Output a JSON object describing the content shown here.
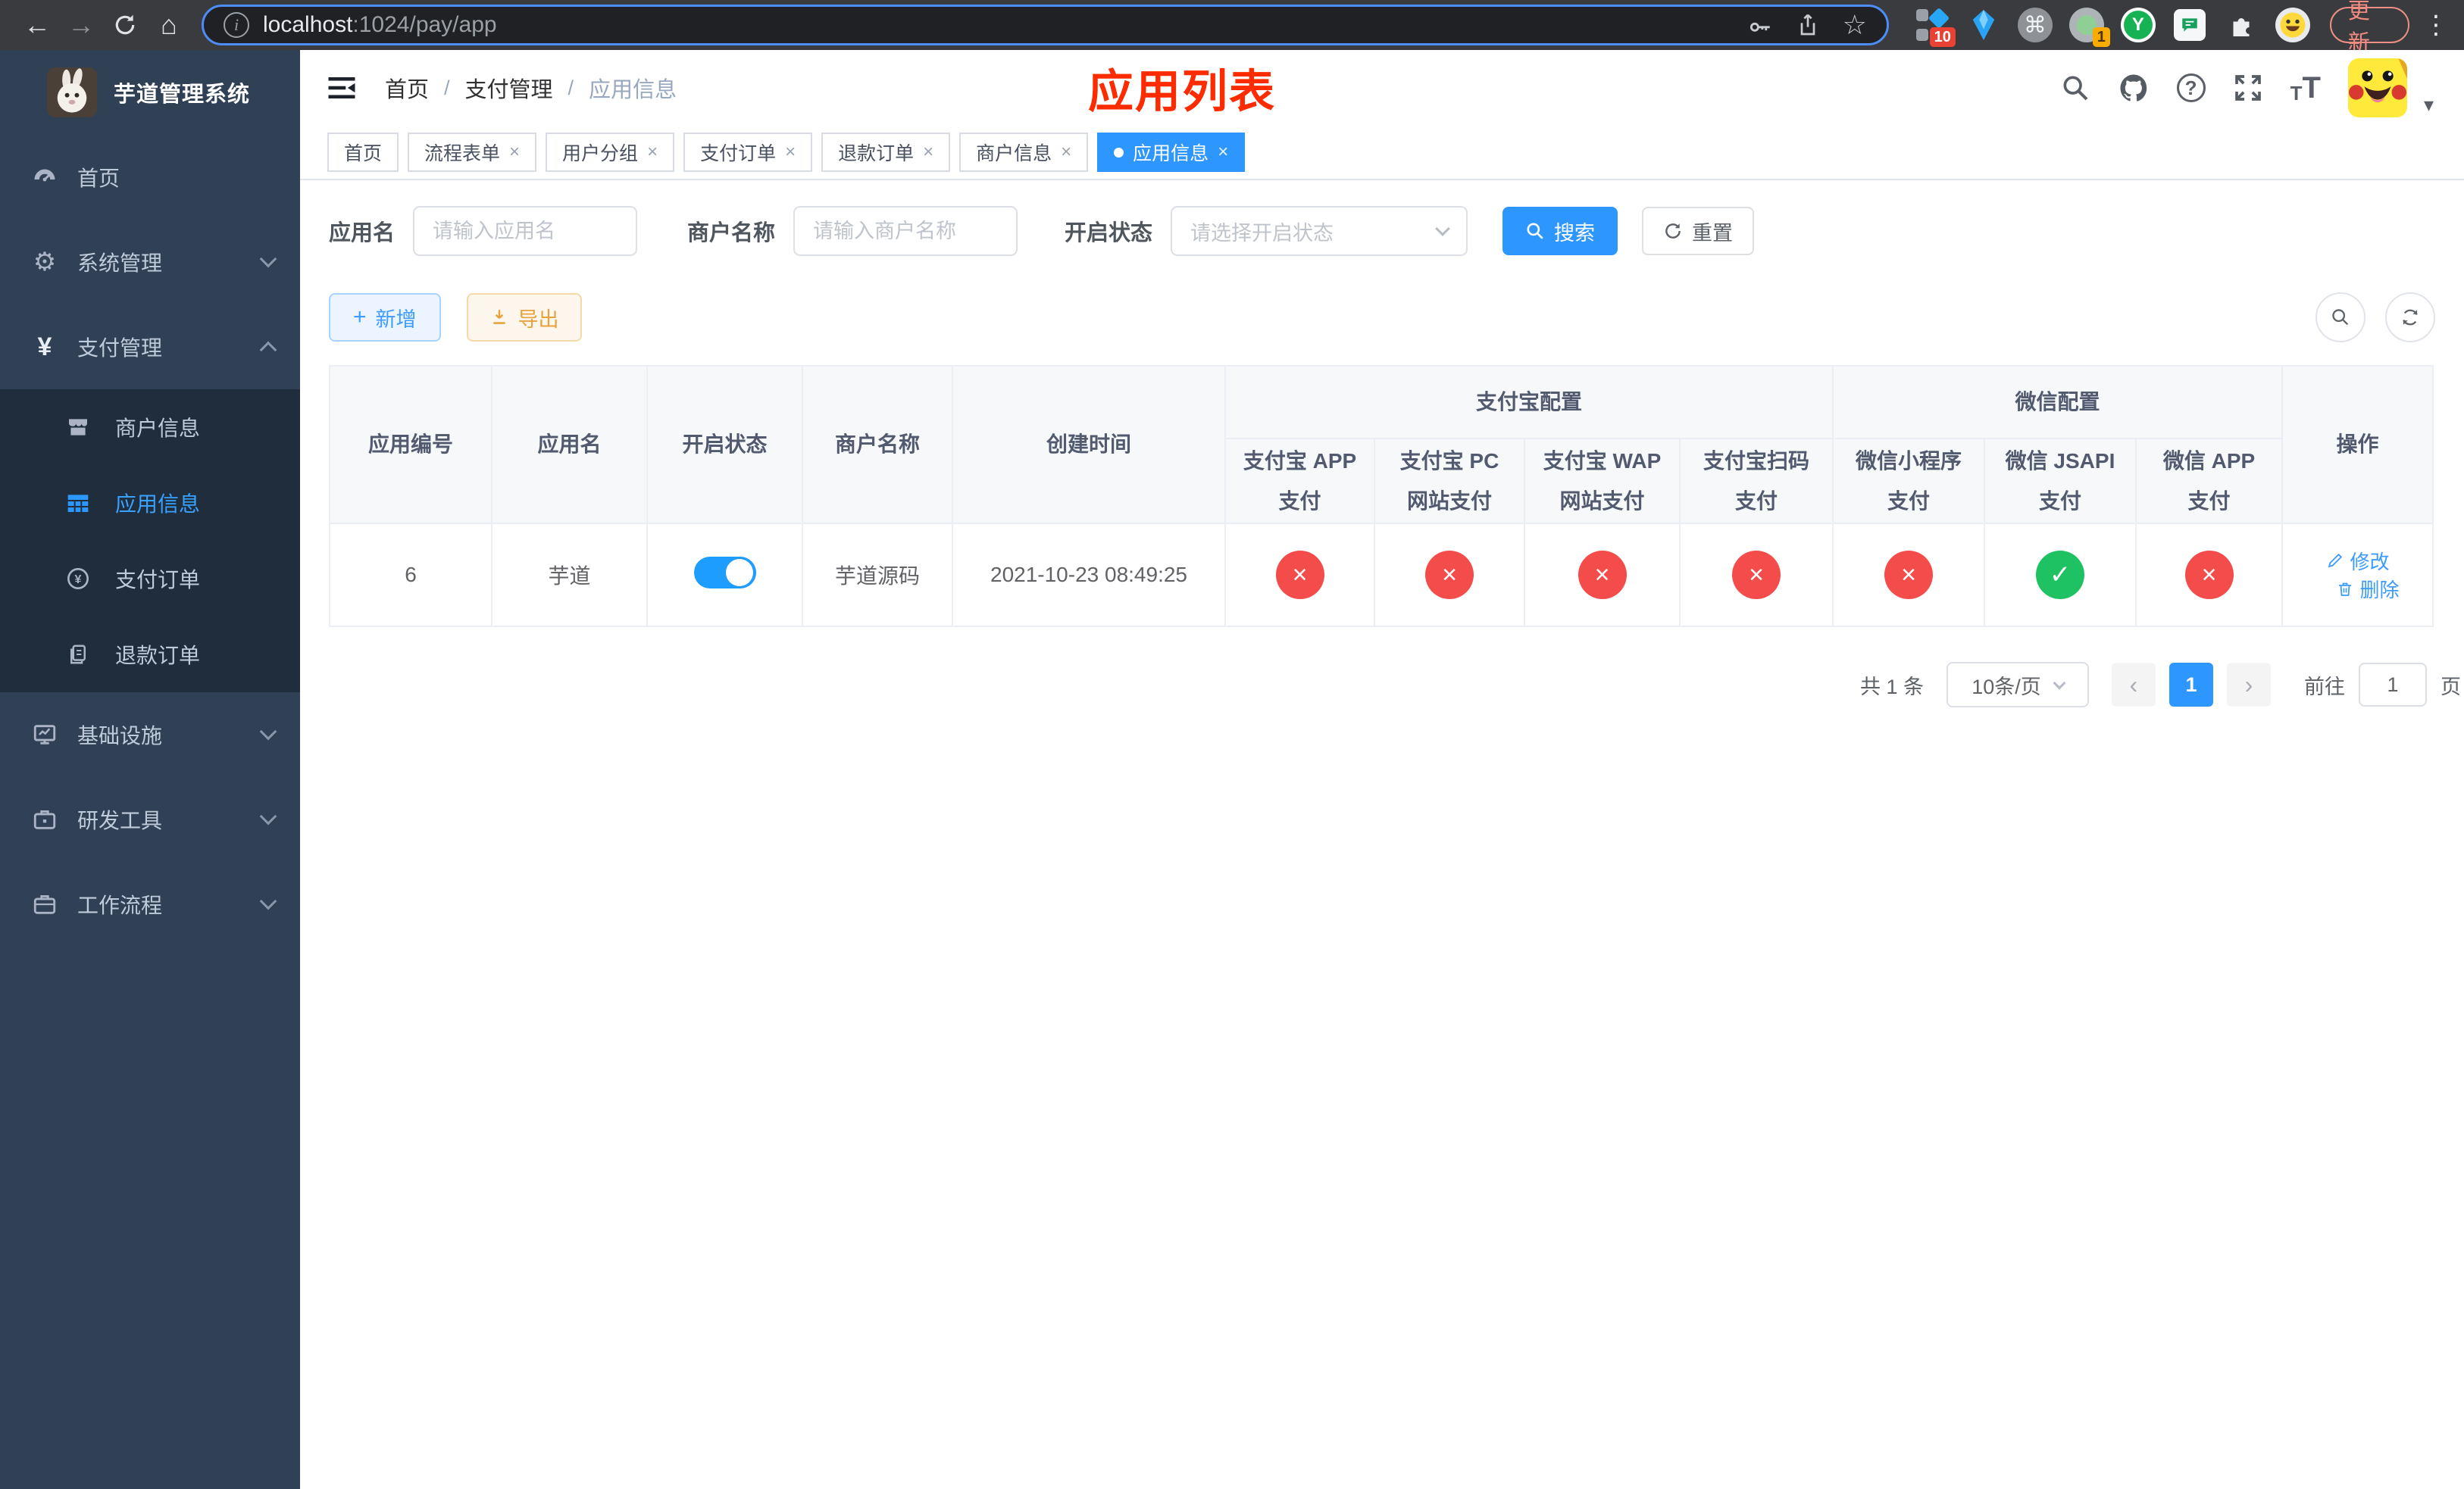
{
  "browser": {
    "url_host": "localhost",
    "url_path": ":1024/pay/app",
    "update_label": "更新",
    "ext_badge_1": "10",
    "ext_badge_2": "1"
  },
  "sidebar": {
    "title": "芋道管理系统",
    "items": [
      {
        "label": "首页"
      },
      {
        "label": "系统管理"
      },
      {
        "label": "支付管理"
      },
      {
        "label": "基础设施"
      },
      {
        "label": "研发工具"
      },
      {
        "label": "工作流程"
      }
    ],
    "submenu": [
      {
        "label": "商户信息"
      },
      {
        "label": "应用信息",
        "active": true
      },
      {
        "label": "支付订单"
      },
      {
        "label": "退款订单"
      }
    ]
  },
  "header": {
    "breadcrumb": [
      "首页",
      "支付管理",
      "应用信息"
    ],
    "annotation": "应用列表"
  },
  "tabs": [
    {
      "label": "首页",
      "closable": false
    },
    {
      "label": "流程表单",
      "closable": true
    },
    {
      "label": "用户分组",
      "closable": true
    },
    {
      "label": "支付订单",
      "closable": true
    },
    {
      "label": "退款订单",
      "closable": true
    },
    {
      "label": "商户信息",
      "closable": true
    },
    {
      "label": "应用信息",
      "closable": true,
      "active": true
    }
  ],
  "filters": {
    "app_name_label": "应用名",
    "app_name_placeholder": "请输入应用名",
    "merchant_label": "商户名称",
    "merchant_placeholder": "请输入商户名称",
    "status_label": "开启状态",
    "status_placeholder": "请选择开启状态",
    "search_label": "搜索",
    "reset_label": "重置"
  },
  "toolbar": {
    "add_label": "新增",
    "export_label": "导出"
  },
  "table": {
    "simple_columns": [
      "应用编号",
      "应用名",
      "开启状态",
      "商户名称",
      "创建时间"
    ],
    "groups": [
      {
        "label": "支付宝配置",
        "children": [
          "支付宝 APP 支付",
          "支付宝 PC 网站支付",
          "支付宝 WAP 网站支付",
          "支付宝扫码支付"
        ]
      },
      {
        "label": "微信配置",
        "children": [
          "微信小程序支付",
          "微信 JSAPI 支付",
          "微信 APP 支付"
        ]
      }
    ],
    "actions_column": "操作",
    "row": {
      "id": "6",
      "name": "芋道",
      "enabled": true,
      "merchant": "芋道源码",
      "created_at": "2021-10-23 08:49:25",
      "statuses": [
        "disabled",
        "disabled",
        "disabled",
        "disabled",
        "disabled",
        "enabled",
        "disabled"
      ],
      "actions": [
        "修改",
        "删除"
      ]
    }
  },
  "pagination": {
    "total": "共 1 条",
    "page_size": "10条/页",
    "page": "1",
    "goto_prefix": "前往",
    "goto_value": "1",
    "goto_suffix": "页"
  },
  "colors": {
    "accent_blue": "#2e96ff",
    "link_blue": "#3d9bff",
    "danger_red": "#f44b4b",
    "success_green": "#1ec263",
    "warning_orange": "#e6a23c",
    "annotation_red": "#fd2b00",
    "sidebar_bg": "#304156",
    "submenu_bg": "#1f2d3d"
  }
}
